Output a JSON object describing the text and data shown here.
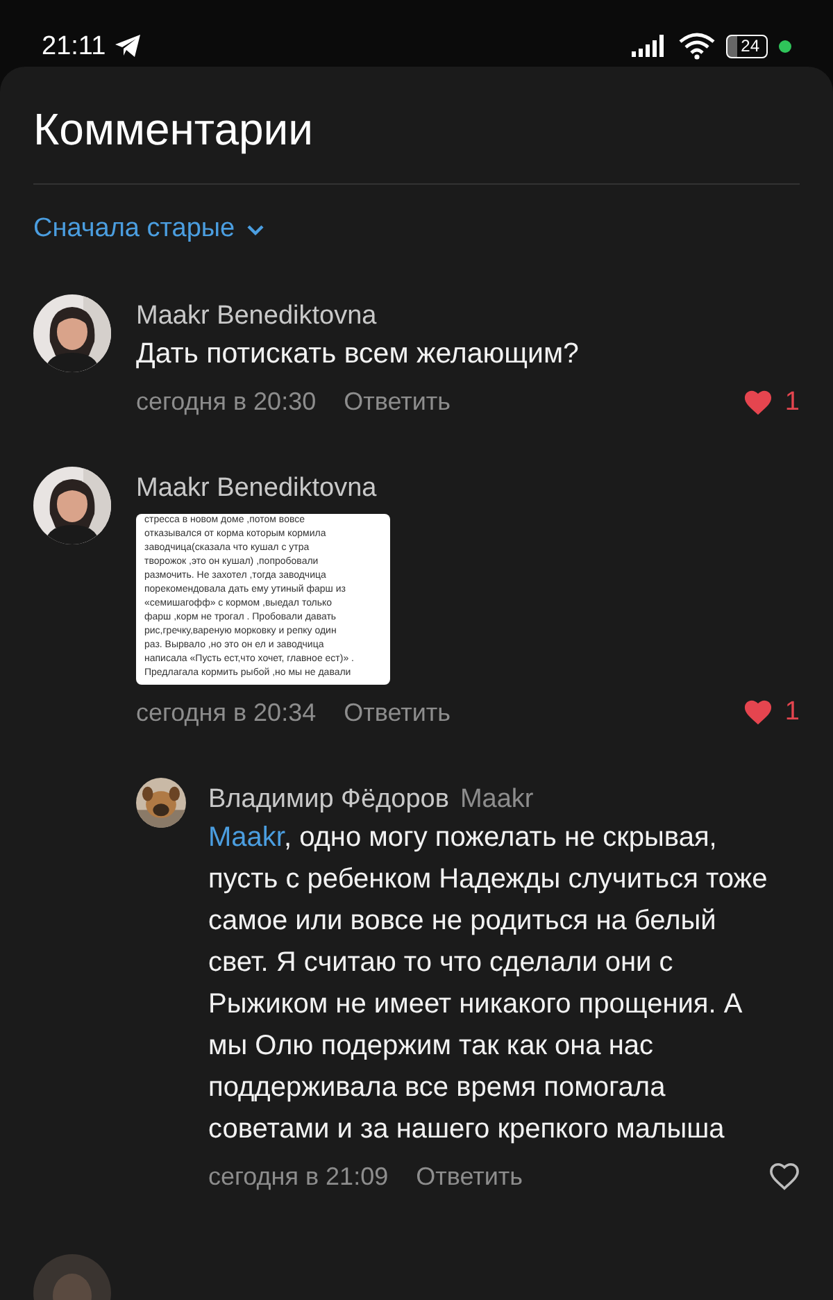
{
  "status_bar": {
    "time": "21:11",
    "battery": "24"
  },
  "title": "Комментарии",
  "sort": {
    "label": "Сначала старые"
  },
  "comments": [
    {
      "author": "Maakr Benediktovna",
      "text": "Дать потискать всем желающим?",
      "time": "сегодня в 20:30",
      "reply_label": "Ответить",
      "liked": true,
      "likes": "1",
      "avatar": {
        "kind": "picture"
      }
    },
    {
      "author": "Maakr Benediktovna",
      "attachment": {
        "lines": [
          "стресса в новом доме ,потом вовсе",
          "отказывался от корма которым кормила",
          "заводчица(сказала что кушал с утра",
          "творожок ,это он кушал) ,попробовали",
          "размочить. Не захотел ,тогда заводчица",
          "порекомендовала дать ему утиный фарш  из",
          "«семишагофф» с кормом ,выедал только",
          "фарш ,корм не трогал . Пробовали давать",
          "рис,гречку,вареную морковку и репку один",
          "раз. Вырвало ,но это он ел и заводчица",
          "написала «Пусть ест,что хочет, главное ест)» .",
          "Предлагала кормить рыбой ,но мы не давали"
        ]
      },
      "time": "сегодня в 20:34",
      "reply_label": "Ответить",
      "liked": true,
      "likes": "1",
      "avatar": {
        "kind": "picture"
      },
      "replies": [
        {
          "author": "Владимир Фёдоров",
          "reply_to": "Maakr",
          "mention": "Maakr",
          "text": ", одно могу пожелать не скрывая, пусть с ребенком Надежды случиться тоже самое или вовсе не родиться на белый свет. Я считаю то что сделали они с Рыжиком не имеет никакого прощения. А мы Олю подержим так как она нас поддерживала все время помогала советами и за нашего крепкого малыша",
          "time": "сегодня в 21:09",
          "reply_label": "Ответить",
          "liked": false,
          "avatar": {
            "kind": "picture"
          }
        }
      ]
    },
    {
      "avatar": {
        "kind": "picture"
      }
    }
  ]
}
